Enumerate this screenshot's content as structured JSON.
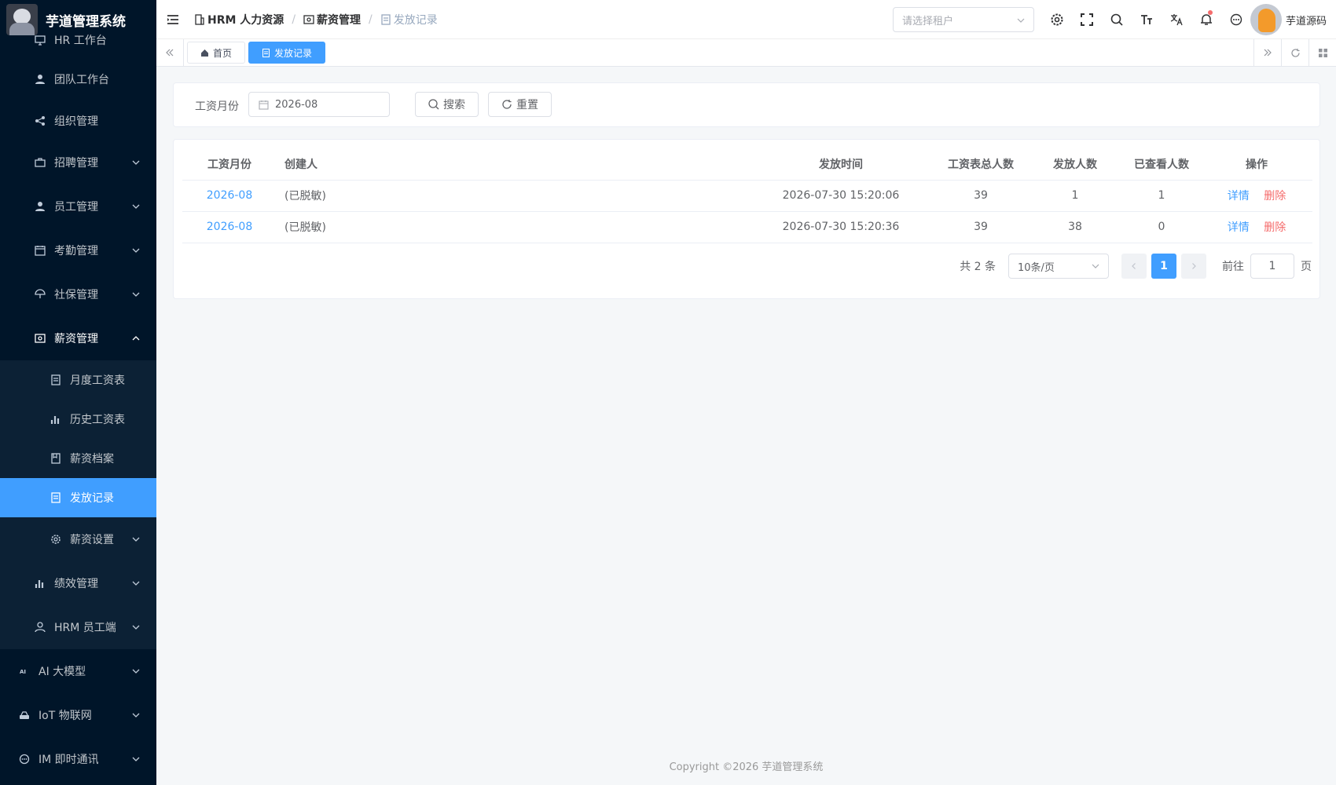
{
  "app": {
    "title": "芋道管理系统"
  },
  "sidebar": {
    "items": [
      {
        "label": "HR 工作台"
      },
      {
        "label": "团队工作台"
      },
      {
        "label": "组织管理"
      },
      {
        "label": "招聘管理"
      },
      {
        "label": "员工管理"
      },
      {
        "label": "考勤管理"
      },
      {
        "label": "社保管理"
      },
      {
        "label": "薪资管理"
      }
    ],
    "sub_items": [
      {
        "label": "月度工资表"
      },
      {
        "label": "历史工资表"
      },
      {
        "label": "薪资档案"
      },
      {
        "label": "发放记录"
      },
      {
        "label": "薪资设置"
      }
    ],
    "after_items": [
      {
        "label": "绩效管理"
      },
      {
        "label": "HRM 员工端"
      }
    ],
    "top_items": [
      {
        "label": "AI 大模型"
      },
      {
        "label": "IoT 物联网"
      },
      {
        "label": "IM 即时通讯"
      }
    ]
  },
  "header": {
    "breadcrumb": [
      "HRM 人力资源",
      "薪资管理",
      "发放记录"
    ],
    "tenant_placeholder": "请选择租户",
    "username": "芋道源码"
  },
  "tabs": [
    {
      "label": "首页"
    },
    {
      "label": "发放记录"
    }
  ],
  "search": {
    "month_label": "工资月份",
    "month_value": "2026-08",
    "search_button": "搜索",
    "reset_button": "重置"
  },
  "table": {
    "columns": [
      "工资月份",
      "创建人",
      "发放时间",
      "工资表总人数",
      "发放人数",
      "已查看人数",
      "操作"
    ],
    "rows": [
      {
        "month": "2026-08",
        "creator": "(已脱敏)",
        "time": "2026-07-30 15:20:06",
        "total": "39",
        "paid": "1",
        "viewed": "1",
        "detail": "详情",
        "delete": "删除"
      },
      {
        "month": "2026-08",
        "creator": "(已脱敏)",
        "time": "2026-07-30 15:20:36",
        "total": "39",
        "paid": "38",
        "viewed": "0",
        "detail": "详情",
        "delete": "删除"
      }
    ]
  },
  "pagination": {
    "total_text": "共 2 条",
    "page_size": "10条/页",
    "current_page": "1",
    "goto_label": "前往",
    "goto_value": "1",
    "page_unit": "页"
  },
  "footer": {
    "copyright": "Copyright ©2026 芋道管理系统"
  },
  "colors": {
    "accent": "#409eff",
    "sidebar_bg": "#001529",
    "danger": "#f56c6c"
  }
}
